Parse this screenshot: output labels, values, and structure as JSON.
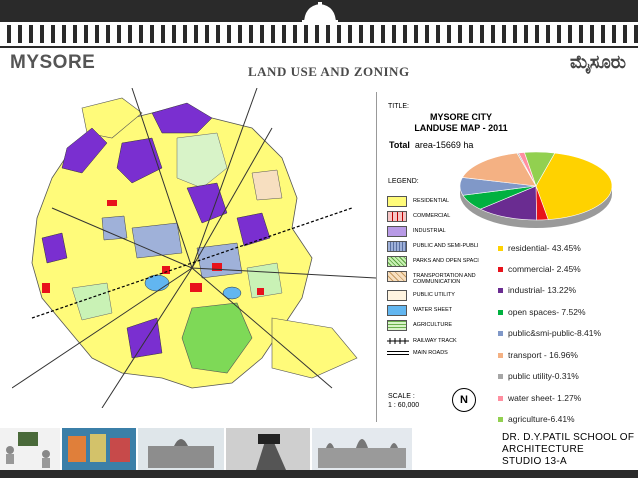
{
  "header": {
    "left_title": "MYSORE",
    "center_title": "LAND USE AND ZONING",
    "right_title": "ಮೈಸೂರು"
  },
  "map_panel": {
    "title_label": "TITLE:",
    "map_title_line1": "MYSORE CITY",
    "map_title_line2": "LANDUSE MAP - 2011",
    "total_label": "Total",
    "total_value": "area-15669 ha",
    "legend_label": "LEGEND:",
    "legend_items": [
      {
        "label": "RESIDENTIAL",
        "color": "#fffb7a"
      },
      {
        "label": "COMMERCIAL",
        "color": "#f6c6c6"
      },
      {
        "label": "INDUSTRIAL",
        "color": "#b89ae6"
      },
      {
        "label": "PUBLIC AND SEMI-PUBLI",
        "color": "#9fb1d9"
      },
      {
        "label": "PARKS AND OPEN SPACI",
        "color": "#c9f2b5"
      },
      {
        "label": "TRANSPORTATION AND COMMUNICATION",
        "color": "#f7dfc0"
      },
      {
        "label": "PUBLIC UTILITY",
        "color": "#fff4e0"
      },
      {
        "label": "WATER SHEET",
        "color": "#62b6f0"
      },
      {
        "label": "AGRICULTURE",
        "color": "#d8f3c8"
      },
      {
        "label": "RAILWAY TRACK",
        "color": "#000000"
      },
      {
        "label": "MAIN ROADS",
        "color": "#000000"
      }
    ],
    "scale_label": "SCALE  :",
    "scale_value": "1 : 60,000",
    "north_label": "N",
    "road_labels": [
      "TO MADIKERI",
      "TO BANGALORE",
      "TO BANGALORE",
      "TO BANGALORE",
      "TO BANNUR",
      "TO T.NARSIPUR",
      "TO MANANTHAVADI",
      "TO HUNSUR",
      "TO OOTY"
    ]
  },
  "chart_data": {
    "type": "pie",
    "categories": [
      "residential",
      "commercial",
      "industrial",
      "open spaces",
      "public&smi-public",
      "transport",
      "public utility",
      "water sheet",
      "agriculture"
    ],
    "values": [
      43.45,
      2.45,
      13.22,
      7.52,
      8.41,
      16.96,
      0.31,
      1.27,
      6.41
    ],
    "colors": [
      "#ffd200",
      "#e8121b",
      "#6a2c91",
      "#00b140",
      "#8098c8",
      "#f4b183",
      "#a6a6a6",
      "#ff8fa0",
      "#92d050"
    ]
  },
  "stats": [
    {
      "text": "residential-   43.45%",
      "color": "#ffd200"
    },
    {
      "text": "commercial-  2.45%",
      "color": "#e8121b"
    },
    {
      "text": "industrial-     13.22%",
      "color": "#6a2c91"
    },
    {
      "text": "open spaces- 7.52%",
      "color": "#00b140"
    },
    {
      "text": "public&smi-public-8.41%",
      "color": "#8098c8"
    },
    {
      "text": "transport     - 16.96%",
      "color": "#f4b183"
    },
    {
      "text": "public utility-0.31%",
      "color": "#a6a6a6"
    },
    {
      "text": "water sheet- 1.27%",
      "color": "#ff8fa0"
    },
    {
      "text": "agriculture-6.41%",
      "color": "#92d050"
    }
  ],
  "footer": {
    "school_line1": "DR. D.Y.PATIL SCHOOL OF",
    "school_line2": "ARCHITECTURE",
    "school_line3": "STUDIO 13-A"
  }
}
